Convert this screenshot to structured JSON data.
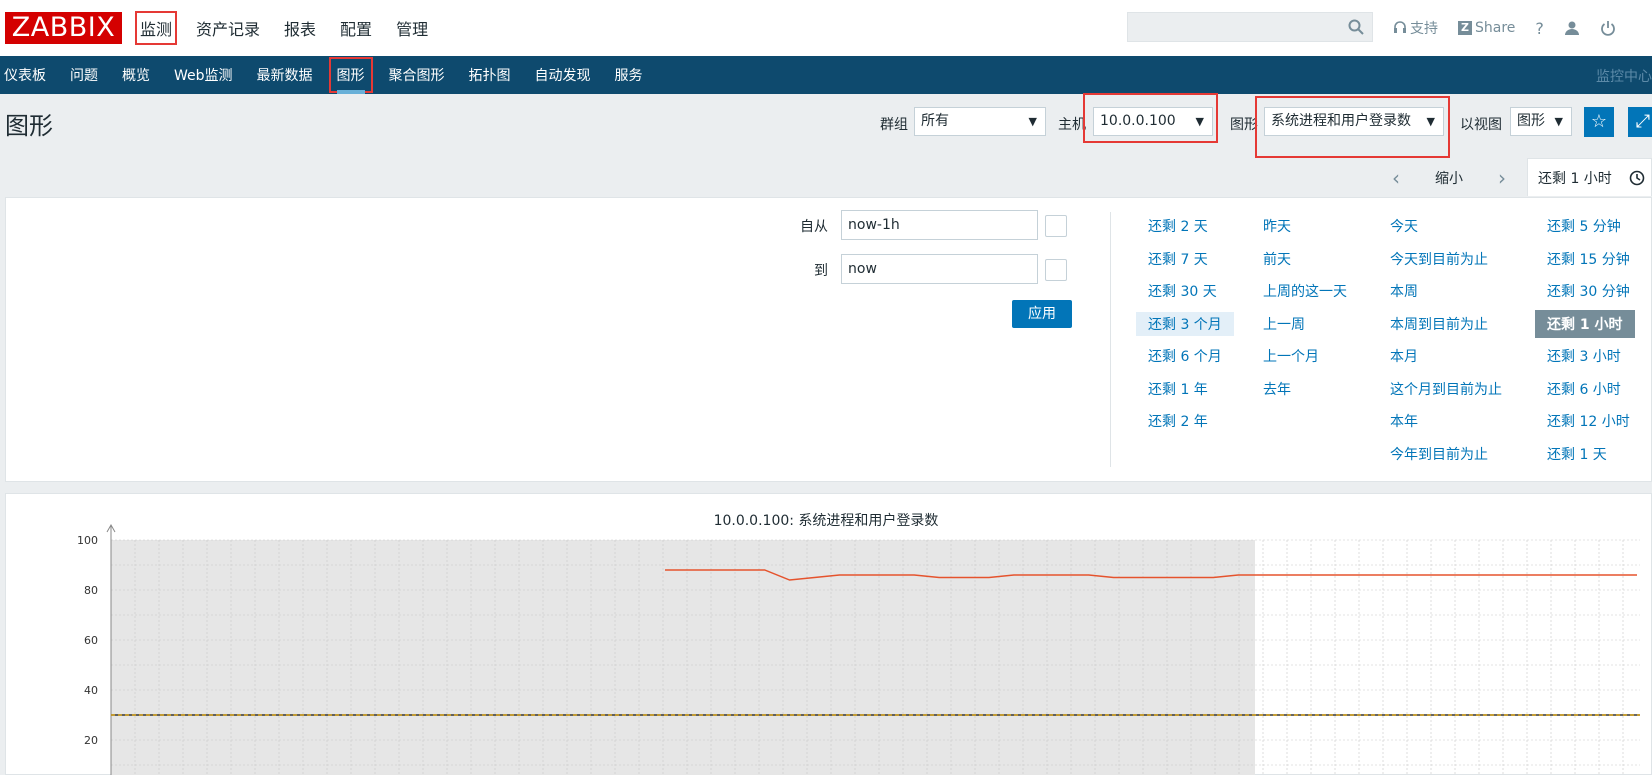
{
  "logo": "ZABBIX",
  "topnav": [
    "监测",
    "资产记录",
    "报表",
    "配置",
    "管理"
  ],
  "top_actions": {
    "support": "支持",
    "share": "Share",
    "help": "?",
    "share_badge": "Z"
  },
  "subnav": [
    "仪表板",
    "问题",
    "概览",
    "Web监测",
    "最新数据",
    "图形",
    "聚合图形",
    "拓扑图",
    "自动发现",
    "服务"
  ],
  "subnav_right": "监控中心",
  "page_title": "图形",
  "filters": {
    "group_label": "群组",
    "group_value": "所有",
    "host_label": "主机",
    "host_value": "10.0.0.100",
    "graph_label": "图形",
    "graph_value": "系统进程和用户登录数",
    "view_label": "以视图",
    "view_value": "图形"
  },
  "timectl": {
    "zoom_out": "缩小",
    "current_tab": "还剩 1 小时"
  },
  "time_selector": {
    "from_label": "自从",
    "from_value": "now-1h",
    "to_label": "到",
    "to_value": "now",
    "apply": "应用"
  },
  "quick_links": {
    "col1": [
      "还剩 2 天",
      "还剩 7 天",
      "还剩 30 天",
      "还剩 3 个月",
      "还剩 6 个月",
      "还剩 1 年",
      "还剩 2 年"
    ],
    "col2": [
      "昨天",
      "前天",
      "上周的这一天",
      "上一周",
      "上一个月",
      "去年"
    ],
    "col3": [
      "今天",
      "今天到目前为止",
      "本周",
      "本周到目前为止",
      "本月",
      "这个月到目前为止",
      "本年",
      "今年到目前为止"
    ],
    "col4": [
      "还剩 5 分钟",
      "还剩 15 分钟",
      "还剩 30 分钟",
      "还剩 1 小时",
      "还剩 3 小时",
      "还剩 6 小时",
      "还剩 12 小时",
      "还剩 1 天"
    ]
  },
  "colors": {
    "brand": "#d40000",
    "nav": "#0e4a6e",
    "link": "#0275b8",
    "highlight": "#e53935",
    "series": "#e5532d",
    "trigger": "#d4a017"
  },
  "chart_data": {
    "type": "line",
    "title": "10.0.0.100: 系统进程和用户登录数",
    "ylim": [
      0,
      100
    ],
    "yticks": [
      20,
      40,
      60,
      80,
      100
    ],
    "series": [
      {
        "values": [
          88,
          88,
          88,
          88,
          88,
          84,
          85,
          86,
          86,
          86,
          86,
          85,
          85,
          85,
          86,
          86,
          86,
          86,
          85,
          85,
          85,
          85,
          85,
          86,
          86,
          86,
          86,
          86,
          86,
          86,
          86,
          86,
          86,
          86,
          86,
          86,
          86,
          86,
          86,
          86
        ]
      }
    ],
    "threshold": 30
  }
}
